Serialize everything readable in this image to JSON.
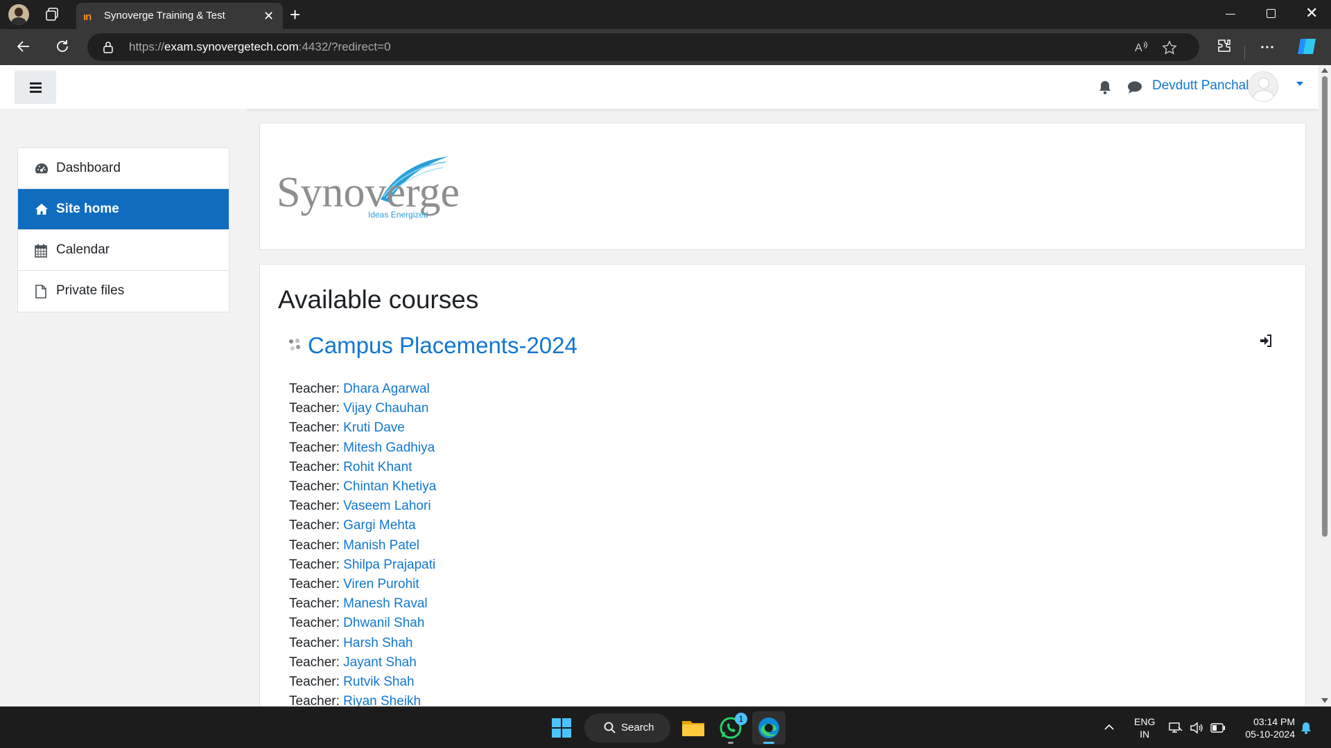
{
  "browser": {
    "tab_title": "Synoverge Training & Test",
    "tab_favicon": "ın",
    "url_prefix": "https://",
    "url_host": "exam.synovergetech.com",
    "url_rest": ":4432/?redirect=0"
  },
  "header": {
    "username": "Devdutt Panchal"
  },
  "sidebar": {
    "items": [
      {
        "label": "Dashboard",
        "icon": "dashboard-icon"
      },
      {
        "label": "Site home",
        "icon": "home-icon",
        "active": true
      },
      {
        "label": "Calendar",
        "icon": "calendar-icon"
      },
      {
        "label": "Private files",
        "icon": "file-icon"
      }
    ]
  },
  "logo": {
    "brand": "Synoverge",
    "tagline": "Ideas Energized"
  },
  "main": {
    "section_title": "Available courses",
    "course": {
      "name": "Campus Placements-2024",
      "teacher_label": "Teacher:",
      "teachers": [
        "Dhara Agarwal",
        "Vijay Chauhan",
        "Kruti Dave",
        "Mitesh Gadhiya",
        "Rohit Khant",
        "Chintan Khetiya",
        "Vaseem Lahori",
        "Gargi Mehta",
        "Manish Patel",
        "Shilpa Prajapati",
        "Viren Purohit",
        "Manesh Raval",
        "Dhwanil Shah",
        "Harsh Shah",
        "Jayant Shah",
        "Rutvik Shah",
        "Riyan Sheikh"
      ]
    }
  },
  "taskbar": {
    "search_label": "Search",
    "whatsapp_badge": "1",
    "lang_line1": "ENG",
    "lang_line2": "IN",
    "time": "03:14 PM",
    "date": "05-10-2024"
  },
  "colors": {
    "link": "#1177d1",
    "active_nav": "#0f6cbf",
    "text": "#1d2125"
  }
}
